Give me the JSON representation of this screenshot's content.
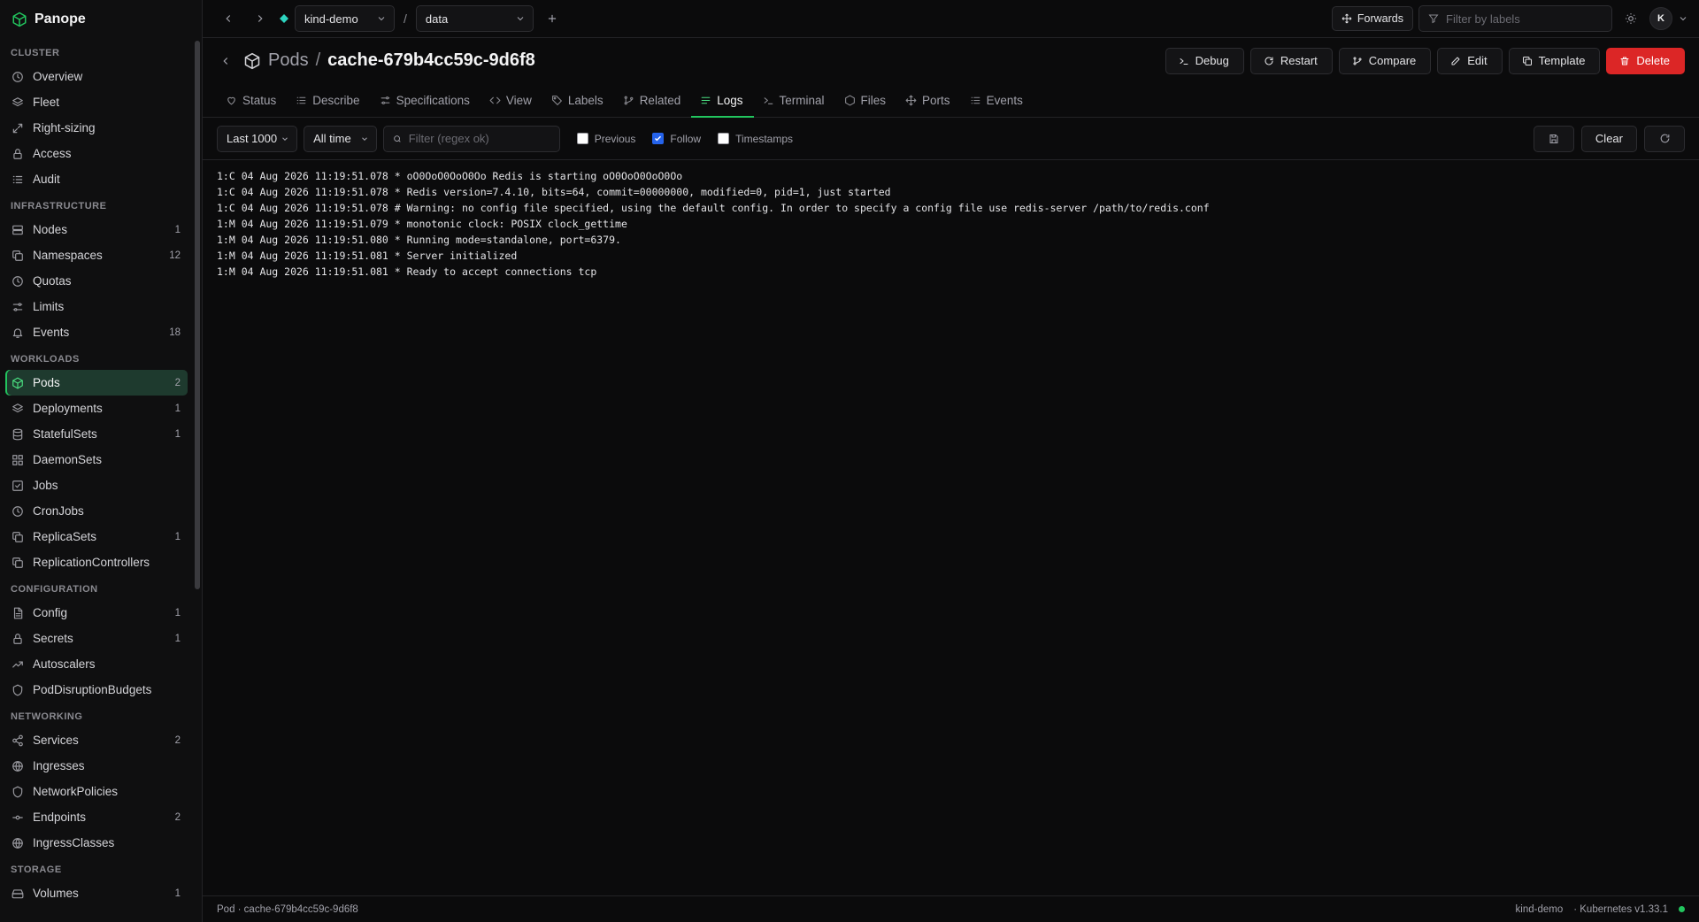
{
  "brand": {
    "name": "Panope",
    "accent": "#22c55e"
  },
  "sidebar": {
    "sections": [
      {
        "title": "CLUSTER",
        "items": [
          {
            "label": "Overview",
            "icon": "clock-icon",
            "count": ""
          },
          {
            "label": "Fleet",
            "icon": "layers-icon",
            "count": ""
          },
          {
            "label": "Right-sizing",
            "icon": "expand-arrows-icon",
            "count": ""
          },
          {
            "label": "Access",
            "icon": "lock-icon",
            "count": ""
          },
          {
            "label": "Audit",
            "icon": "list-icon",
            "count": ""
          }
        ]
      },
      {
        "title": "INFRASTRUCTURE",
        "items": [
          {
            "label": "Nodes",
            "icon": "server-icon",
            "count": "1"
          },
          {
            "label": "Namespaces",
            "icon": "copy-icon",
            "count": "12"
          },
          {
            "label": "Quotas",
            "icon": "clock-icon",
            "count": ""
          },
          {
            "label": "Limits",
            "icon": "sliders-icon",
            "count": ""
          },
          {
            "label": "Events",
            "icon": "bell-icon",
            "count": "18"
          }
        ]
      },
      {
        "title": "WORKLOADS",
        "items": [
          {
            "label": "Pods",
            "icon": "cube-icon",
            "count": "2",
            "active": true
          },
          {
            "label": "Deployments",
            "icon": "layers-icon",
            "count": "1"
          },
          {
            "label": "StatefulSets",
            "icon": "database-icon",
            "count": "1"
          },
          {
            "label": "DaemonSets",
            "icon": "grid-icon",
            "count": ""
          },
          {
            "label": "Jobs",
            "icon": "check-square-icon",
            "count": ""
          },
          {
            "label": "CronJobs",
            "icon": "clock-icon",
            "count": ""
          },
          {
            "label": "ReplicaSets",
            "icon": "copy-icon",
            "count": "1"
          },
          {
            "label": "ReplicationControllers",
            "icon": "copy-icon",
            "count": ""
          }
        ]
      },
      {
        "title": "CONFIGURATION",
        "items": [
          {
            "label": "Config",
            "icon": "file-icon",
            "count": "1"
          },
          {
            "label": "Secrets",
            "icon": "lock-icon",
            "count": "1"
          },
          {
            "label": "Autoscalers",
            "icon": "trend-up-icon",
            "count": ""
          },
          {
            "label": "PodDisruptionBudgets",
            "icon": "shield-icon",
            "count": ""
          }
        ]
      },
      {
        "title": "NETWORKING",
        "items": [
          {
            "label": "Services",
            "icon": "share-icon",
            "count": "2"
          },
          {
            "label": "Ingresses",
            "icon": "globe-icon",
            "count": ""
          },
          {
            "label": "NetworkPolicies",
            "icon": "shield-icon",
            "count": ""
          },
          {
            "label": "Endpoints",
            "icon": "commit-icon",
            "count": "2"
          },
          {
            "label": "IngressClasses",
            "icon": "globe-icon",
            "count": ""
          }
        ]
      },
      {
        "title": "STORAGE",
        "items": [
          {
            "label": "Volumes",
            "icon": "hard-drive-icon",
            "count": "1"
          }
        ]
      }
    ]
  },
  "topbar": {
    "context": "kind-demo",
    "separator": "/",
    "namespace": "data",
    "forwards_label": "Forwards",
    "filter_placeholder": "Filter by labels",
    "avatar_initial": "K"
  },
  "header": {
    "crumb": "Pods",
    "separator": "/",
    "name": "cache-679b4cc59c-9d6f8",
    "actions": [
      {
        "label": "Debug",
        "icon": "terminal-icon"
      },
      {
        "label": "Restart",
        "icon": "rotate-icon"
      },
      {
        "label": "Compare",
        "icon": "branch-icon"
      },
      {
        "label": "Edit",
        "icon": "pencil-icon"
      },
      {
        "label": "Template",
        "icon": "copy-icon"
      }
    ],
    "delete_label": "Delete",
    "delete_color": "#dc2626"
  },
  "tabs": [
    {
      "label": "Status",
      "icon": "heart-icon"
    },
    {
      "label": "Describe",
      "icon": "list-icon"
    },
    {
      "label": "Specifications",
      "icon": "sliders-icon"
    },
    {
      "label": "View",
      "icon": "code-icon"
    },
    {
      "label": "Labels",
      "icon": "tag-icon"
    },
    {
      "label": "Related",
      "icon": "branch-icon"
    },
    {
      "label": "Logs",
      "icon": "lines-icon",
      "active": true
    },
    {
      "label": "Terminal",
      "icon": "terminal-icon"
    },
    {
      "label": "Files",
      "icon": "hexagon-icon"
    },
    {
      "label": "Ports",
      "icon": "move-icon"
    },
    {
      "label": "Events",
      "icon": "list-icon"
    }
  ],
  "logs_toolbar": {
    "lines_select": "Last 1000",
    "time_select": "All time",
    "filter_placeholder": "Filter (regex ok)",
    "previous_label": "Previous",
    "previous_checked": false,
    "follow_label": "Follow",
    "follow_checked": true,
    "timestamps_label": "Timestamps",
    "timestamps_checked": false,
    "clear_label": "Clear"
  },
  "log_lines": [
    "1:C 04 Aug 2026 11:19:51.078 * oO0OoO0OoO0Oo Redis is starting oO0OoO0OoO0Oo",
    "1:C 04 Aug 2026 11:19:51.078 * Redis version=7.4.10, bits=64, commit=00000000, modified=0, pid=1, just started",
    "1:C 04 Aug 2026 11:19:51.078 # Warning: no config file specified, using the default config. In order to specify a config file use redis-server /path/to/redis.conf",
    "1:M 04 Aug 2026 11:19:51.079 * monotonic clock: POSIX clock_gettime",
    "1:M 04 Aug 2026 11:19:51.080 * Running mode=standalone, port=6379.",
    "1:M 04 Aug 2026 11:19:51.081 * Server initialized",
    "1:M 04 Aug 2026 11:19:51.081 * Ready to accept connections tcp"
  ],
  "statusbar": {
    "left": "Pod · cache-679b4cc59c-9d6f8",
    "context": "kind-demo",
    "version": "· Kubernetes v1.33.1",
    "status_color": "#22c55e"
  }
}
